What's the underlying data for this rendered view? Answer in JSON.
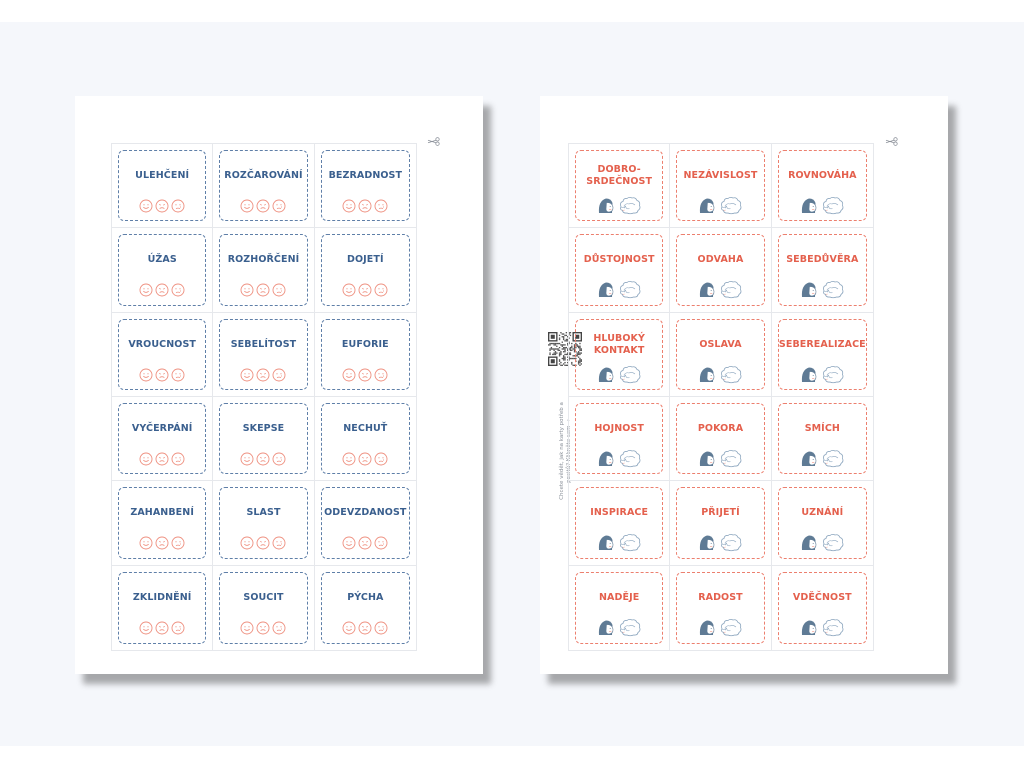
{
  "colors": {
    "blue_ink": "#3a5f8e",
    "blue_border": "#5f7fa8",
    "coral_ink": "#e4604d",
    "coral_border": "#ec7f6e",
    "face_stroke": "#ee8f7f",
    "hair": "#5f7b95"
  },
  "left_sheet": {
    "cards": [
      "ULEHČENÍ",
      "ROZČAROVÁNÍ",
      "BEZRADNOST",
      "ÚŽAS",
      "ROZHOŘČENÍ",
      "DOJETÍ",
      "VROUCNOST",
      "SEBELÍTOST",
      "EUFORIE",
      "VYČERPÁNÍ",
      "SKEPSE",
      "NECHUŤ",
      "ZAHANBENÍ",
      "SLAST",
      "ODEVZDANOST",
      "ZKLIDNĚNÍ",
      "SOUCIT",
      "PÝCHA"
    ],
    "card_icons": [
      "smile-face-icon",
      "neutral-face-icon",
      "sad-face-icon"
    ],
    "cut_icon": "scissors-icon"
  },
  "right_sheet": {
    "cards": [
      "DOBRO-\nSRDEČNOST",
      "NEZÁVISLOST",
      "ROVNOVÁHA",
      "DŮSTOJNOST",
      "ODVAHA",
      "SEBEDŮVĚRA",
      "HLUBOKÝ\nKONTAKT",
      "OSLAVA",
      "SEBEREALIZACE",
      "HOJNOST",
      "POKORA",
      "SMÍCH",
      "INSPIRACE",
      "PŘIJETÍ",
      "UZNÁNÍ",
      "NADĚJE",
      "RADOST",
      "VDĚČNOST"
    ],
    "card_icons": [
      "dark-haired-head-icon",
      "curly-haired-head-icon"
    ],
    "cut_icon": "scissors-icon",
    "qr_icon": "qr-code-icon",
    "side_note": "Chcete vědět, jak na karty potřeb a pocitů? Klikněte sem →"
  }
}
